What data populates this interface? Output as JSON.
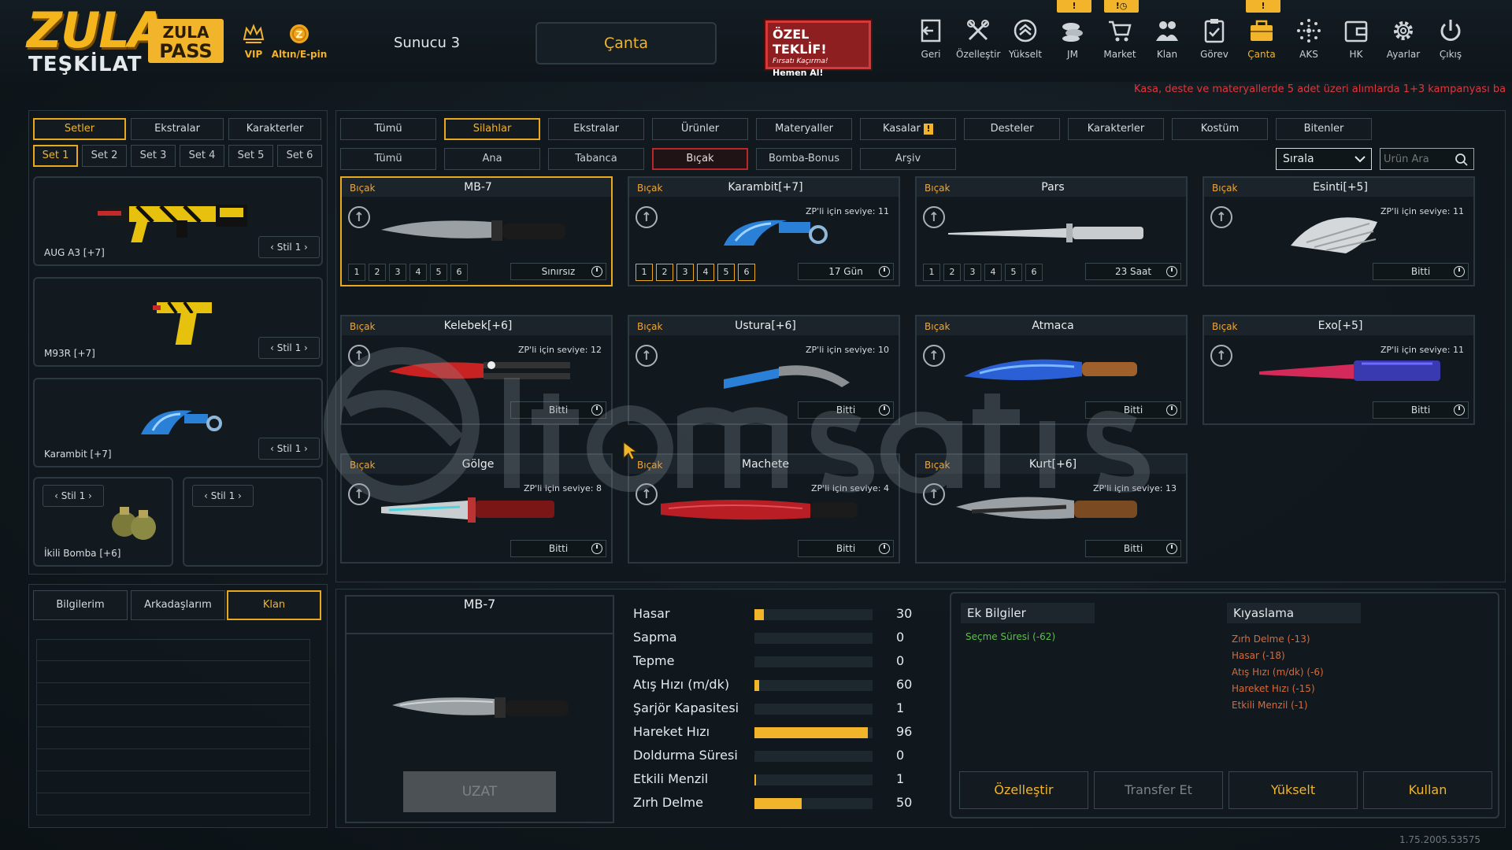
{
  "topbar": {
    "logo_line1": "ZULA",
    "logo_line2": "TEŞKİLAT",
    "pass_line1": "ZULA",
    "pass_line2": "PASS",
    "vip_label": "VIP",
    "gold_label": "Altın/E-pin",
    "server": "Sunucu 3",
    "canta_button": "Çanta",
    "offer": {
      "title": "ÖZEL TEKLİF!",
      "subtitle": "Fırsatı Kaçırma!",
      "cta": "Hemen Al!"
    },
    "icons": [
      {
        "label": "Geri",
        "icon": "back-icon"
      },
      {
        "label": "Özelleştir",
        "icon": "tools-icon"
      },
      {
        "label": "Yükselt",
        "icon": "upgrade-icon"
      },
      {
        "label": "JM",
        "icon": "coins-icon",
        "badge": "!"
      },
      {
        "label": "Market",
        "icon": "cart-icon"
      },
      {
        "label": "Klan",
        "icon": "clan-icon",
        "badge": "!◷"
      },
      {
        "label": "Görev",
        "icon": "mission-icon"
      },
      {
        "label": "Çanta",
        "icon": "bag-icon",
        "badge": "!"
      },
      {
        "label": "AKS",
        "icon": "aks-icon"
      },
      {
        "label": "HK",
        "icon": "wallet-icon"
      },
      {
        "label": "Ayarlar",
        "icon": "gear-icon"
      },
      {
        "label": "Çıkış",
        "icon": "power-icon"
      }
    ],
    "marquee": "Kasa, deste ve materyallerde 5 adet üzeri alımlarda 1+3 kampanyası ba"
  },
  "left": {
    "tabs": [
      "Setler",
      "Ekstralar",
      "Karakterler"
    ],
    "active_tab": "Setler",
    "sets": [
      "Set 1",
      "Set 2",
      "Set 3",
      "Set 4",
      "Set 5",
      "Set 6"
    ],
    "active_set": "Set 1",
    "slots": [
      {
        "label": "AUG A3 [+7]",
        "style": "Stil 1"
      },
      {
        "label": "M93R [+7]",
        "style": "Stil 1"
      },
      {
        "label": "Karambit [+7]",
        "style": "Stil 1"
      }
    ],
    "bomb_slot": {
      "label": "İkili Bomba [+6]",
      "style": "Stil 1"
    },
    "empty_slot": {
      "style": "Stil 1"
    },
    "social_tabs": [
      "Bilgilerim",
      "Arkadaşlarım",
      "Klan"
    ],
    "active_social": "Klan"
  },
  "categories": [
    "Tümü",
    "Silahlar",
    "Ekstralar",
    "Ürünler",
    "Materyaller",
    "Kasalar",
    "Desteler",
    "Karakterler",
    "Kostüm",
    "Bitenler"
  ],
  "active_category": "Silahlar",
  "subcategories": [
    "Tümü",
    "Ana",
    "Tabanca",
    "Bıçak",
    "Bomba-Bonus",
    "Arşiv"
  ],
  "active_subcategory": "Bıçak",
  "sort": {
    "label": "Sırala"
  },
  "search": {
    "placeholder": "Ürün Ara"
  },
  "items": [
    {
      "cat": "Bıçak",
      "name": "MB-7",
      "level": "",
      "slots": [
        "1",
        "2",
        "3",
        "4",
        "5",
        "6"
      ],
      "duration": "Sınırsız",
      "selected": true
    },
    {
      "cat": "Bıçak",
      "name": "Karambit[+7]",
      "level": "ZP'li için seviye: 11",
      "slots": [
        "1",
        "2",
        "3",
        "4",
        "5",
        "6"
      ],
      "duration": "17 Gün"
    },
    {
      "cat": "Bıçak",
      "name": "Pars",
      "level": "",
      "slots": [
        "1",
        "2",
        "3",
        "4",
        "5",
        "6"
      ],
      "duration": "23 Saat"
    },
    {
      "cat": "Bıçak",
      "name": "Esinti[+5]",
      "level": "ZP'li için seviye: 11",
      "slots": [],
      "duration": "Bitti"
    },
    {
      "cat": "Bıçak",
      "name": "Kelebek[+6]",
      "level": "ZP'li için seviye: 12",
      "slots": [],
      "duration": "Bitti"
    },
    {
      "cat": "Bıçak",
      "name": "Ustura[+6]",
      "level": "ZP'li için seviye: 10",
      "slots": [],
      "duration": "Bitti"
    },
    {
      "cat": "Bıçak",
      "name": "Atmaca",
      "level": "",
      "slots": [],
      "duration": "Bitti"
    },
    {
      "cat": "Bıçak",
      "name": "Exo[+5]",
      "level": "ZP'li için seviye: 11",
      "slots": [],
      "duration": "Bitti"
    },
    {
      "cat": "Bıçak",
      "name": "Gölge",
      "level": "ZP'li için seviye: 8",
      "slots": [],
      "duration": "Bitti"
    },
    {
      "cat": "Bıçak",
      "name": "Machete",
      "level": "ZP'li için seviye: 4",
      "slots": [],
      "duration": "Bitti"
    },
    {
      "cat": "Bıçak",
      "name": "Kurt[+6]",
      "level": "ZP'li için seviye: 13",
      "slots": [],
      "duration": "Bitti"
    }
  ],
  "detail": {
    "name": "MB-7",
    "extend_button": "UZAT",
    "stats": [
      {
        "label": "Hasar",
        "value": "30",
        "fill": 0.08
      },
      {
        "label": "Sapma",
        "value": "0",
        "fill": 0
      },
      {
        "label": "Tepme",
        "value": "0",
        "fill": 0
      },
      {
        "label": "Atış Hızı (m/dk)",
        "value": "60",
        "fill": 0.04
      },
      {
        "label": "Şarjör Kapasitesi",
        "value": "1",
        "fill": 0
      },
      {
        "label": "Hareket Hızı",
        "value": "96",
        "fill": 0.96
      },
      {
        "label": "Doldurma Süresi",
        "value": "0",
        "fill": 0
      },
      {
        "label": "Etkili Menzil",
        "value": "1",
        "fill": 0.01
      },
      {
        "label": "Zırh Delme",
        "value": "50",
        "fill": 0.4
      }
    ]
  },
  "info": {
    "extra_title": "Ek Bilgiler",
    "extra_items": [
      "Seçme Süresi (-62)"
    ],
    "compare_title": "Kıyaslama",
    "compare_items": [
      "Zırh Delme (-13)",
      "Hasar (-18)",
      "Atış Hızı (m/dk) (-6)",
      "Hareket Hızı (-15)",
      "Etkili Menzil (-1)"
    ]
  },
  "actions": [
    "Özelleştir",
    "Transfer Et",
    "Yükselt",
    "Kullan"
  ],
  "version": "1.75.2005.53575",
  "colors": {
    "accent": "#f1b42a",
    "danger": "#e0363c",
    "positive": "#5fbf4f",
    "negative": "#d86a3a"
  }
}
